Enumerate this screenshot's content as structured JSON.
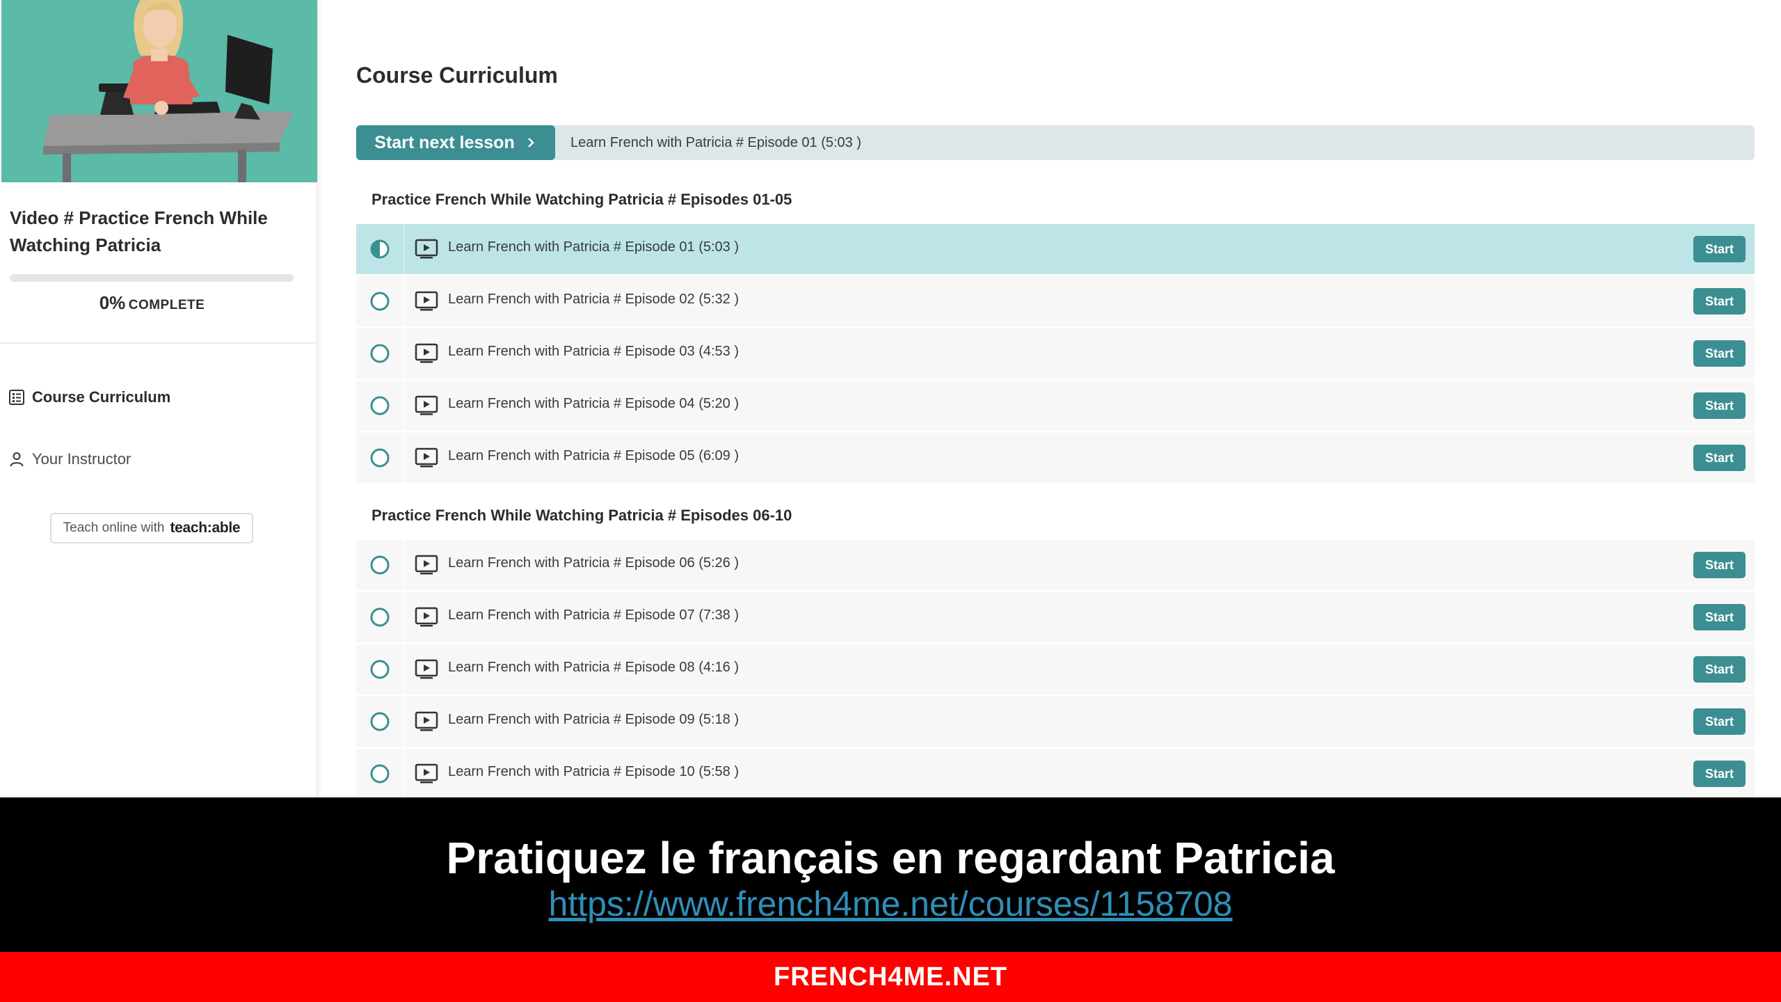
{
  "sidebar": {
    "course_title": "Video # Practice French While Watching Patricia",
    "progress": {
      "percent_value": 0,
      "percent": "0%",
      "label": "COMPLETE"
    },
    "nav": [
      {
        "label": "Course Curriculum",
        "icon": "curriculum-list-icon"
      },
      {
        "label": "Your Instructor",
        "icon": "user-icon"
      }
    ],
    "teach_badge": {
      "prefix": "Teach online with",
      "brand": "teach:able"
    }
  },
  "main": {
    "title": "Course Curriculum",
    "next": {
      "button_label": "Start next lesson",
      "lesson": "Learn French with Patricia # Episode 01 (5:03 )"
    },
    "sections": [
      {
        "title": "Practice French While Watching Patricia # Episodes 01-05",
        "lessons": [
          {
            "name": "Learn French with Patricia # Episode 01 (5:03 )",
            "action": "Start",
            "status": "in-progress"
          },
          {
            "name": "Learn French with Patricia # Episode 02 (5:32 )",
            "action": "Start",
            "status": "not-started"
          },
          {
            "name": "Learn French with Patricia # Episode 03 (4:53 )",
            "action": "Start",
            "status": "not-started"
          },
          {
            "name": "Learn French with Patricia # Episode 04 (5:20 )",
            "action": "Start",
            "status": "not-started"
          },
          {
            "name": "Learn French with Patricia # Episode 05 (6:09 )",
            "action": "Start",
            "status": "not-started"
          }
        ]
      },
      {
        "title": "Practice French While Watching Patricia # Episodes 06-10",
        "lessons": [
          {
            "name": "Learn French with Patricia # Episode 06 (5:26 )",
            "action": "Start",
            "status": "not-started"
          },
          {
            "name": "Learn French with Patricia # Episode 07 (7:38 )",
            "action": "Start",
            "status": "not-started"
          },
          {
            "name": "Learn French with Patricia # Episode 08 (4:16 )",
            "action": "Start",
            "status": "not-started"
          },
          {
            "name": "Learn French with Patricia # Episode 09 (5:18 )",
            "action": "Start",
            "status": "not-started"
          },
          {
            "name": "Learn French with Patricia # Episode 10 (5:58 )",
            "action": "Start",
            "status": "not-started"
          }
        ]
      }
    ]
  },
  "banner": {
    "headline": "Pratiquez le français en regardant Patricia",
    "link": "https://www.french4me.net/courses/1158708",
    "footer": "FRENCH4ME.NET"
  },
  "colors": {
    "accent": "#3b8f92",
    "current_row": "#bde5e7",
    "thumb_bg": "#5bbaa8",
    "footer_red": "#ff0000"
  }
}
